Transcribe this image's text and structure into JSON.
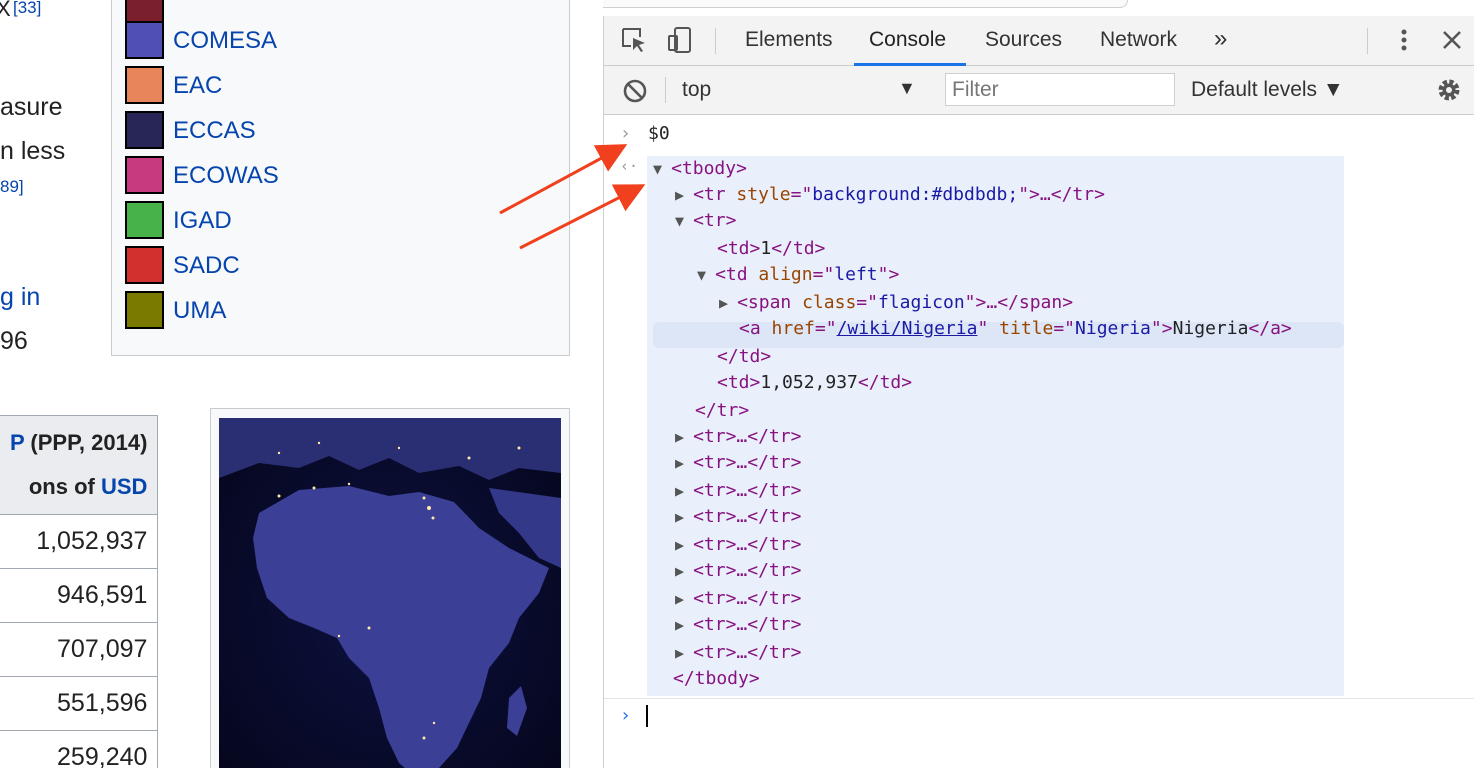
{
  "wiki": {
    "fragments": {
      "ref_top": "[33]",
      "x_top": "X",
      "measure": "asure",
      "less": "n less",
      "ref_89": "89]",
      "gin": "g in",
      "n96": "96"
    },
    "legend": [
      {
        "label": "COMESA",
        "color": "#4f4fb5"
      },
      {
        "label": "EAC",
        "color": "#e8855a"
      },
      {
        "label": "ECCAS",
        "color": "#272657"
      },
      {
        "label": "ECOWAS",
        "color": "#c83a7f"
      },
      {
        "label": "IGAD",
        "color": "#47b24a"
      },
      {
        "label": "SADC",
        "color": "#d2302f"
      },
      {
        "label": "UMA",
        "color": "#7a7a00"
      }
    ],
    "legend_top_color": "#7a1f2e",
    "table": {
      "header_link": "P",
      "header_rest": " (PPP, 2014)",
      "header_line2_pre": "ons of ",
      "header_line2_link": "USD",
      "values": [
        "1,052,937",
        "946,591",
        "707,097",
        "551,596",
        "259,240"
      ]
    }
  },
  "devtools": {
    "tabs": [
      "Elements",
      "Console",
      "Sources",
      "Network"
    ],
    "more_tabs": "»",
    "active_tab": "Console",
    "accent_color": "#1a73e8",
    "toolbar": {
      "context": "top",
      "filter_placeholder": "Filter",
      "levels": "Default levels ▼"
    },
    "console": {
      "input": "$0",
      "tbody_open": "<tbody>",
      "tbody_close": "</tbody>",
      "row1_tag": "<tr ",
      "row1_attr": "style",
      "row1_val": "background:#dbdbdb;",
      "row1_end": "…</tr>",
      "tr_open": "<tr>",
      "td1_open": "<td>",
      "td1_text": "1",
      "td_close": "</td>",
      "td2_tag": "<td ",
      "td2_attr": "align",
      "td2_val": "left",
      "span_tag": "<span ",
      "span_attr": "class",
      "span_val": "flagicon",
      "span_end": "…</span>",
      "a_tag": "<a ",
      "a_href_attr": "href",
      "a_href_val": "/wiki/Nigeria",
      "a_title_attr": "title",
      "a_title_val": "Nigeria",
      "a_text": "Nigeria",
      "a_close": "</a>",
      "td3_text": "1,052,937",
      "tr_close": "</tr>",
      "collapsed_row": "<tr>…</tr>",
      "collapsed_count": 9
    }
  }
}
